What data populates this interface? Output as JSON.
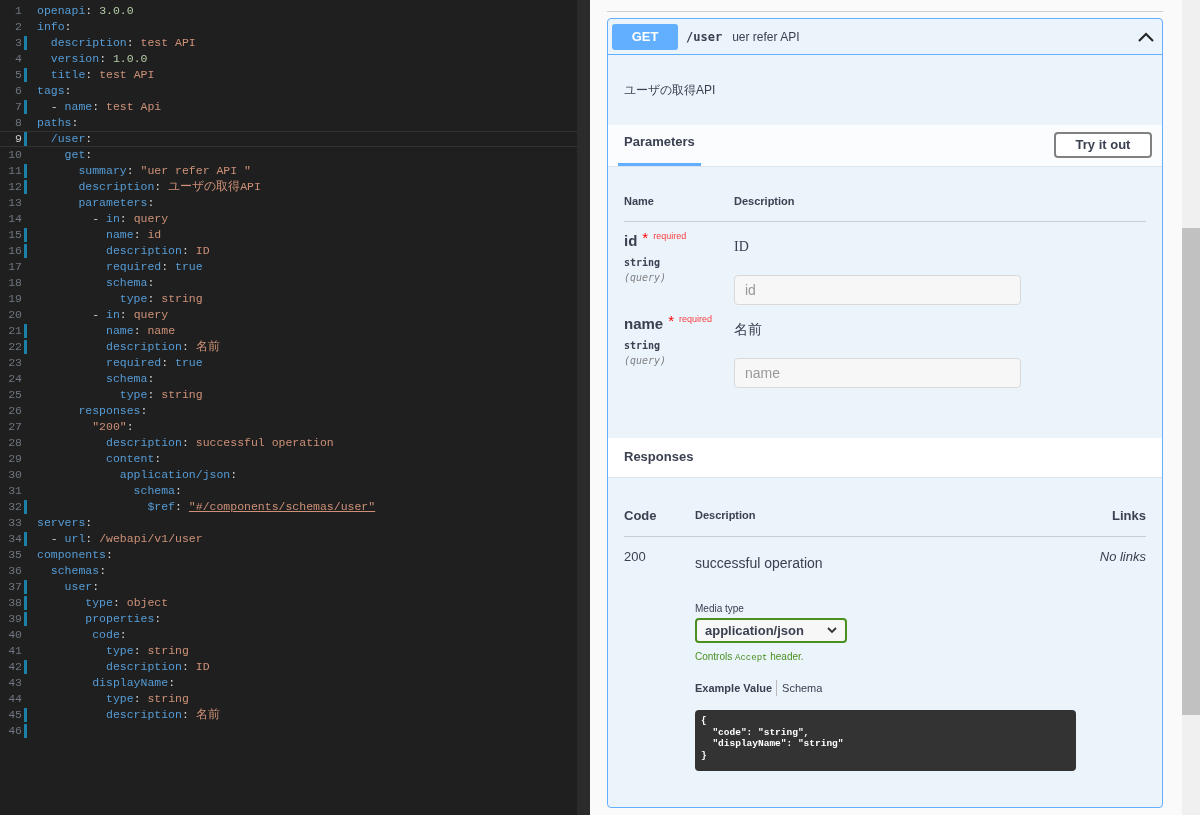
{
  "editor": {
    "lines": [
      {
        "num": "1",
        "modified": false,
        "current": false,
        "tokens": [
          {
            "text": "openapi",
            "kind": "key"
          },
          {
            "text": ": ",
            "kind": "punct"
          },
          {
            "text": "3.0.0",
            "kind": "number"
          }
        ]
      },
      {
        "num": "2",
        "modified": false,
        "current": false,
        "tokens": [
          {
            "text": "info",
            "kind": "key"
          },
          {
            "text": ":",
            "kind": "punct"
          }
        ]
      },
      {
        "num": "3",
        "modified": true,
        "current": false,
        "tokens": [
          {
            "text": "  description",
            "kind": "key"
          },
          {
            "text": ": ",
            "kind": "punct"
          },
          {
            "text": "test API",
            "kind": "string"
          }
        ]
      },
      {
        "num": "4",
        "modified": false,
        "current": false,
        "tokens": [
          {
            "text": "  version",
            "kind": "key"
          },
          {
            "text": ": ",
            "kind": "punct"
          },
          {
            "text": "1.0.0",
            "kind": "number"
          }
        ]
      },
      {
        "num": "5",
        "modified": true,
        "current": false,
        "tokens": [
          {
            "text": "  title",
            "kind": "key"
          },
          {
            "text": ": ",
            "kind": "punct"
          },
          {
            "text": "test API",
            "kind": "string"
          }
        ]
      },
      {
        "num": "6",
        "modified": false,
        "current": false,
        "tokens": [
          {
            "text": "tags",
            "kind": "key"
          },
          {
            "text": ":",
            "kind": "punct"
          }
        ]
      },
      {
        "num": "7",
        "modified": true,
        "current": false,
        "tokens": [
          {
            "text": "  - ",
            "kind": "punct"
          },
          {
            "text": "name",
            "kind": "key"
          },
          {
            "text": ": ",
            "kind": "punct"
          },
          {
            "text": "test Api",
            "kind": "string"
          }
        ]
      },
      {
        "num": "8",
        "modified": false,
        "current": false,
        "tokens": [
          {
            "text": "paths",
            "kind": "key"
          },
          {
            "text": ":",
            "kind": "punct"
          }
        ]
      },
      {
        "num": "9",
        "modified": true,
        "current": true,
        "tokens": [
          {
            "text": "  /user",
            "kind": "key"
          },
          {
            "text": ":",
            "kind": "punct"
          }
        ]
      },
      {
        "num": "10",
        "modified": false,
        "current": false,
        "tokens": [
          {
            "text": "    get",
            "kind": "key"
          },
          {
            "text": ":",
            "kind": "punct"
          }
        ]
      },
      {
        "num": "11",
        "modified": true,
        "current": false,
        "tokens": [
          {
            "text": "      summary",
            "kind": "key"
          },
          {
            "text": ": ",
            "kind": "punct"
          },
          {
            "text": "\"uer refer API \"",
            "kind": "string"
          }
        ]
      },
      {
        "num": "12",
        "modified": true,
        "current": false,
        "tokens": [
          {
            "text": "      description",
            "kind": "key"
          },
          {
            "text": ": ",
            "kind": "punct"
          },
          {
            "text": "ユーザの取得API",
            "kind": "string"
          }
        ]
      },
      {
        "num": "13",
        "modified": false,
        "current": false,
        "tokens": [
          {
            "text": "      parameters",
            "kind": "key"
          },
          {
            "text": ":",
            "kind": "punct"
          }
        ]
      },
      {
        "num": "14",
        "modified": false,
        "current": false,
        "tokens": [
          {
            "text": "        - ",
            "kind": "punct"
          },
          {
            "text": "in",
            "kind": "key"
          },
          {
            "text": ": ",
            "kind": "punct"
          },
          {
            "text": "query",
            "kind": "string"
          }
        ]
      },
      {
        "num": "15",
        "modified": true,
        "current": false,
        "tokens": [
          {
            "text": "          name",
            "kind": "key"
          },
          {
            "text": ": ",
            "kind": "punct"
          },
          {
            "text": "id",
            "kind": "string"
          }
        ]
      },
      {
        "num": "16",
        "modified": true,
        "current": false,
        "tokens": [
          {
            "text": "          description",
            "kind": "key"
          },
          {
            "text": ": ",
            "kind": "punct"
          },
          {
            "text": "ID",
            "kind": "string"
          }
        ]
      },
      {
        "num": "17",
        "modified": false,
        "current": false,
        "tokens": [
          {
            "text": "          required",
            "kind": "key"
          },
          {
            "text": ": ",
            "kind": "punct"
          },
          {
            "text": "true",
            "kind": "keyword"
          }
        ]
      },
      {
        "num": "18",
        "modified": false,
        "current": false,
        "tokens": [
          {
            "text": "          schema",
            "kind": "key"
          },
          {
            "text": ":",
            "kind": "punct"
          }
        ]
      },
      {
        "num": "19",
        "modified": false,
        "current": false,
        "tokens": [
          {
            "text": "            type",
            "kind": "key"
          },
          {
            "text": ": ",
            "kind": "punct"
          },
          {
            "text": "string",
            "kind": "string"
          }
        ]
      },
      {
        "num": "20",
        "modified": false,
        "current": false,
        "tokens": [
          {
            "text": "        - ",
            "kind": "punct"
          },
          {
            "text": "in",
            "kind": "key"
          },
          {
            "text": ": ",
            "kind": "punct"
          },
          {
            "text": "query",
            "kind": "string"
          }
        ]
      },
      {
        "num": "21",
        "modified": true,
        "current": false,
        "tokens": [
          {
            "text": "          name",
            "kind": "key"
          },
          {
            "text": ": ",
            "kind": "punct"
          },
          {
            "text": "name",
            "kind": "string"
          }
        ]
      },
      {
        "num": "22",
        "modified": true,
        "current": false,
        "tokens": [
          {
            "text": "          description",
            "kind": "key"
          },
          {
            "text": ": ",
            "kind": "punct"
          },
          {
            "text": "名前",
            "kind": "string"
          }
        ]
      },
      {
        "num": "23",
        "modified": false,
        "current": false,
        "tokens": [
          {
            "text": "          required",
            "kind": "key"
          },
          {
            "text": ": ",
            "kind": "punct"
          },
          {
            "text": "true",
            "kind": "keyword"
          }
        ]
      },
      {
        "num": "24",
        "modified": false,
        "current": false,
        "tokens": [
          {
            "text": "          schema",
            "kind": "key"
          },
          {
            "text": ":",
            "kind": "punct"
          }
        ]
      },
      {
        "num": "25",
        "modified": false,
        "current": false,
        "tokens": [
          {
            "text": "            type",
            "kind": "key"
          },
          {
            "text": ": ",
            "kind": "punct"
          },
          {
            "text": "string",
            "kind": "string"
          }
        ]
      },
      {
        "num": "26",
        "modified": false,
        "current": false,
        "tokens": [
          {
            "text": "      responses",
            "kind": "key"
          },
          {
            "text": ":",
            "kind": "punct"
          }
        ]
      },
      {
        "num": "27",
        "modified": false,
        "current": false,
        "tokens": [
          {
            "text": "        \"200\"",
            "kind": "string"
          },
          {
            "text": ":",
            "kind": "punct"
          }
        ]
      },
      {
        "num": "28",
        "modified": false,
        "current": false,
        "tokens": [
          {
            "text": "          description",
            "kind": "key"
          },
          {
            "text": ": ",
            "kind": "punct"
          },
          {
            "text": "successful operation",
            "kind": "string"
          }
        ]
      },
      {
        "num": "29",
        "modified": false,
        "current": false,
        "tokens": [
          {
            "text": "          content",
            "kind": "key"
          },
          {
            "text": ":",
            "kind": "punct"
          }
        ]
      },
      {
        "num": "30",
        "modified": false,
        "current": false,
        "tokens": [
          {
            "text": "            application/json",
            "kind": "key"
          },
          {
            "text": ":",
            "kind": "punct"
          }
        ]
      },
      {
        "num": "31",
        "modified": false,
        "current": false,
        "tokens": [
          {
            "text": "              schema",
            "kind": "key"
          },
          {
            "text": ":",
            "kind": "punct"
          }
        ]
      },
      {
        "num": "32",
        "modified": true,
        "current": false,
        "tokens": [
          {
            "text": "                $ref",
            "kind": "key"
          },
          {
            "text": ": ",
            "kind": "punct"
          },
          {
            "text": "\"#/components/schemas/user\"",
            "kind": "link"
          }
        ]
      },
      {
        "num": "33",
        "modified": false,
        "current": false,
        "tokens": [
          {
            "text": "servers",
            "kind": "key"
          },
          {
            "text": ":",
            "kind": "punct"
          }
        ]
      },
      {
        "num": "34",
        "modified": true,
        "current": false,
        "tokens": [
          {
            "text": "  - ",
            "kind": "punct"
          },
          {
            "text": "url",
            "kind": "key"
          },
          {
            "text": ": ",
            "kind": "punct"
          },
          {
            "text": "/webapi/v1/user",
            "kind": "string"
          }
        ]
      },
      {
        "num": "35",
        "modified": false,
        "current": false,
        "tokens": [
          {
            "text": "components",
            "kind": "key"
          },
          {
            "text": ":",
            "kind": "punct"
          }
        ]
      },
      {
        "num": "36",
        "modified": false,
        "current": false,
        "tokens": [
          {
            "text": "  schemas",
            "kind": "key"
          },
          {
            "text": ":",
            "kind": "punct"
          }
        ]
      },
      {
        "num": "37",
        "modified": true,
        "current": false,
        "tokens": [
          {
            "text": "    user",
            "kind": "key"
          },
          {
            "text": ":",
            "kind": "punct"
          }
        ]
      },
      {
        "num": "38",
        "modified": true,
        "current": false,
        "tokens": [
          {
            "text": "       type",
            "kind": "key"
          },
          {
            "text": ": ",
            "kind": "punct"
          },
          {
            "text": "object",
            "kind": "string"
          }
        ]
      },
      {
        "num": "39",
        "modified": true,
        "current": false,
        "tokens": [
          {
            "text": "       properties",
            "kind": "key"
          },
          {
            "text": ":",
            "kind": "punct"
          }
        ]
      },
      {
        "num": "40",
        "modified": false,
        "current": false,
        "tokens": [
          {
            "text": "        code",
            "kind": "key"
          },
          {
            "text": ":",
            "kind": "punct"
          }
        ]
      },
      {
        "num": "41",
        "modified": false,
        "current": false,
        "tokens": [
          {
            "text": "          type",
            "kind": "key"
          },
          {
            "text": ": ",
            "kind": "punct"
          },
          {
            "text": "string",
            "kind": "string"
          }
        ]
      },
      {
        "num": "42",
        "modified": true,
        "current": false,
        "tokens": [
          {
            "text": "          description",
            "kind": "key"
          },
          {
            "text": ": ",
            "kind": "punct"
          },
          {
            "text": "ID",
            "kind": "string"
          }
        ]
      },
      {
        "num": "43",
        "modified": false,
        "current": false,
        "tokens": [
          {
            "text": "        displayName",
            "kind": "key"
          },
          {
            "text": ":",
            "kind": "punct"
          }
        ]
      },
      {
        "num": "44",
        "modified": false,
        "current": false,
        "tokens": [
          {
            "text": "          type",
            "kind": "key"
          },
          {
            "text": ": ",
            "kind": "punct"
          },
          {
            "text": "string",
            "kind": "string"
          }
        ]
      },
      {
        "num": "45",
        "modified": true,
        "current": false,
        "tokens": [
          {
            "text": "          description",
            "kind": "key"
          },
          {
            "text": ": ",
            "kind": "punct"
          },
          {
            "text": "名前",
            "kind": "string"
          }
        ]
      },
      {
        "num": "46",
        "modified": true,
        "current": false
      }
    ]
  },
  "operation": {
    "method": "GET",
    "path": "/user",
    "summary": "uer refer API",
    "expanded": true,
    "description": "ユーザの取得API",
    "parameters": {
      "tab": "Parameters",
      "try_button": "Try it out",
      "columns": [
        "Name",
        "Description"
      ],
      "rows": [
        {
          "name": "id",
          "required_mark": "*",
          "required_label": "required",
          "type": "string",
          "location": "(query)",
          "description": "ID",
          "placeholder": "id"
        },
        {
          "name": "name",
          "required_mark": "*",
          "required_label": "required",
          "type": "string",
          "location": "(query)",
          "description": "名前",
          "placeholder": "name"
        }
      ]
    },
    "responses": {
      "title": "Responses",
      "columns": [
        "Code",
        "Description",
        "Links"
      ],
      "rows": [
        {
          "code": "200",
          "description": "successful operation",
          "links": "No links",
          "media_label": "Media type",
          "media_value": "application/json",
          "media_note_before": "Controls",
          "media_note_code": "Accept",
          "media_note_after": "header.",
          "example_tabs": [
            {
              "label": "Example Value",
              "selected": true
            },
            {
              "label": "Schema",
              "selected": false
            }
          ],
          "example": [
            "{",
            "  \"code\": \"string\",",
            "  \"displayName\": \"string\"",
            "}"
          ]
        }
      ]
    }
  }
}
